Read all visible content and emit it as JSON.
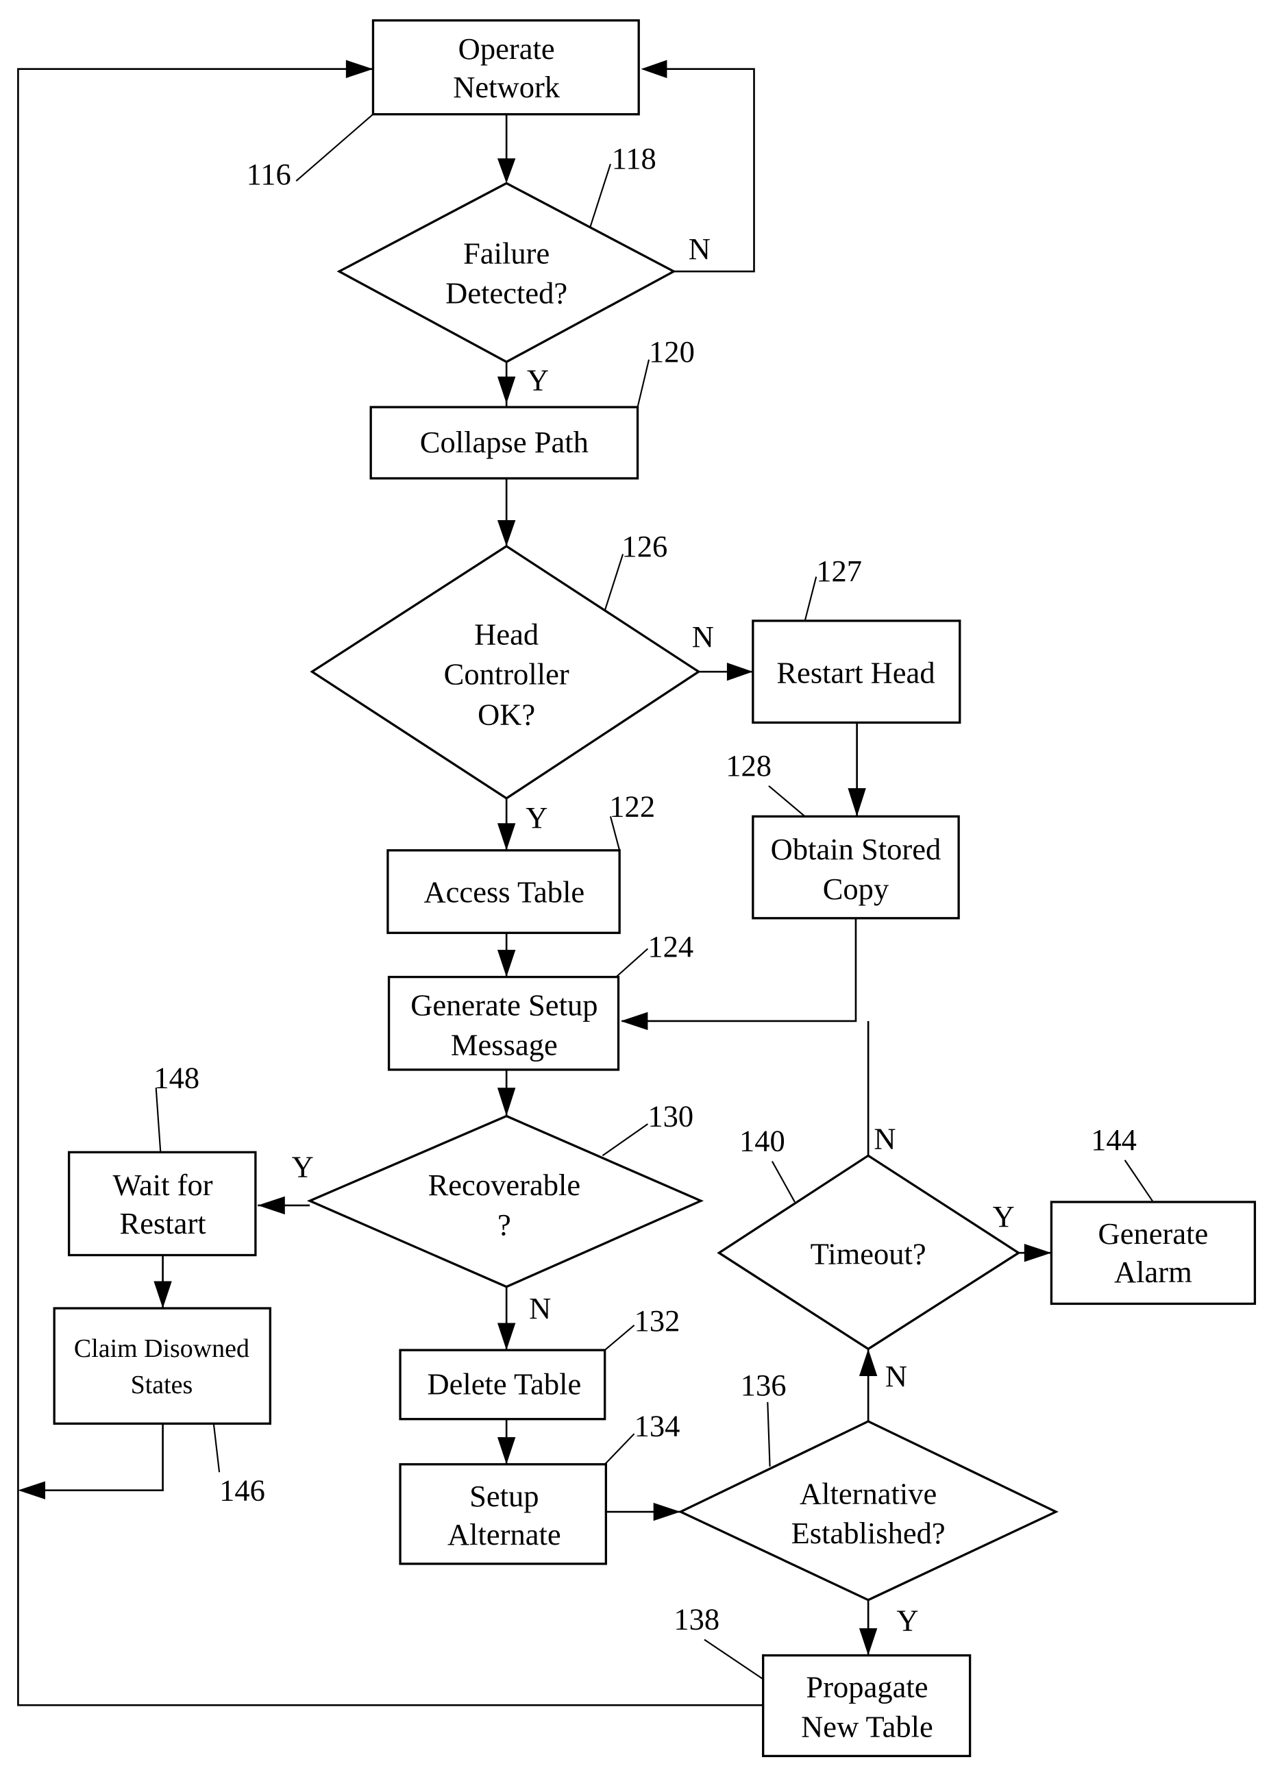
{
  "nodes": {
    "n116": {
      "ref": "116",
      "type": "process",
      "lines": [
        "Operate",
        "Network"
      ]
    },
    "n118": {
      "ref": "118",
      "type": "decision",
      "lines": [
        "Failure",
        "Detected?"
      ]
    },
    "n120": {
      "ref": "120",
      "type": "process",
      "lines": [
        "Collapse Path"
      ]
    },
    "n126": {
      "ref": "126",
      "type": "decision",
      "lines": [
        "Head",
        "Controller",
        "OK?"
      ]
    },
    "n127": {
      "ref": "127",
      "type": "process",
      "lines": [
        "Restart Head"
      ]
    },
    "n128": {
      "ref": "128",
      "type": "process",
      "lines": [
        "Obtain Stored",
        "Copy"
      ]
    },
    "n122": {
      "ref": "122",
      "type": "process",
      "lines": [
        "Access Table"
      ]
    },
    "n124": {
      "ref": "124",
      "type": "process",
      "lines": [
        "Generate Setup",
        "Message"
      ]
    },
    "n130": {
      "ref": "130",
      "type": "decision",
      "lines": [
        "Recoverable",
        "?"
      ]
    },
    "n148": {
      "ref": "148",
      "type": "process",
      "lines": [
        "Wait for",
        "Restart"
      ]
    },
    "n146": {
      "ref": "146",
      "type": "process",
      "lines": [
        "Claim Disowned",
        "States"
      ]
    },
    "n132": {
      "ref": "132",
      "type": "process",
      "lines": [
        "Delete Table"
      ]
    },
    "n134": {
      "ref": "134",
      "type": "process",
      "lines": [
        "Setup",
        "Alternate"
      ]
    },
    "n136": {
      "ref": "136",
      "type": "decision",
      "lines": [
        "Alternative",
        "Established?"
      ]
    },
    "n140": {
      "ref": "140",
      "type": "decision",
      "lines": [
        "Timeout?"
      ]
    },
    "n144": {
      "ref": "144",
      "type": "process",
      "lines": [
        "Generate",
        "Alarm"
      ]
    },
    "n138": {
      "ref": "138",
      "type": "process",
      "lines": [
        "Propagate",
        "New Table"
      ]
    }
  },
  "edge_labels": {
    "failure_no": "N",
    "failure_yes": "Y",
    "head_no": "N",
    "head_yes": "Y",
    "recoverable_yes": "Y",
    "recoverable_no": "N",
    "timeout_no": "N",
    "timeout_yes": "Y",
    "alternative_no": "N",
    "alternative_yes": "Y"
  }
}
